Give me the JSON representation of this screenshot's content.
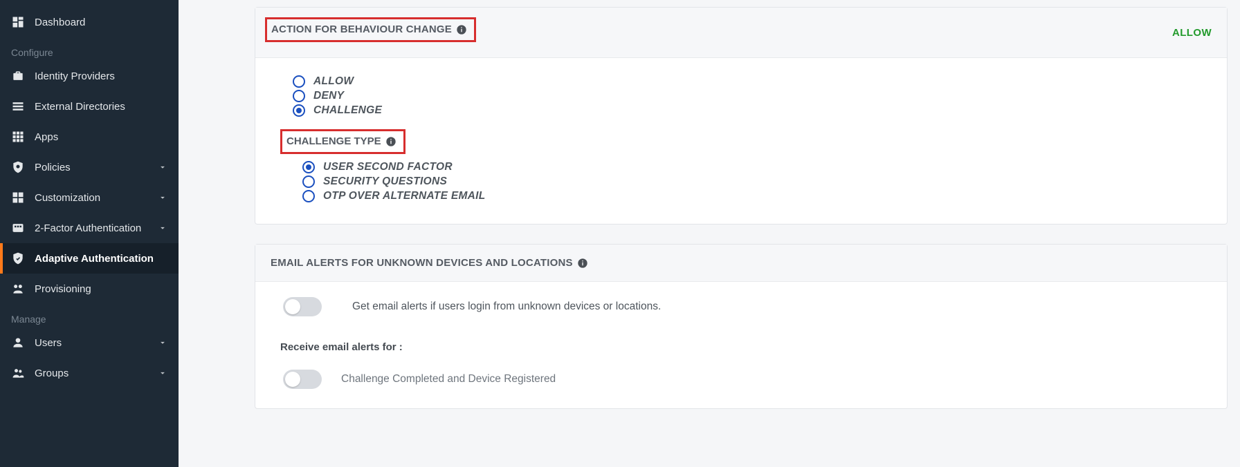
{
  "sidebar": {
    "configure_label": "Configure",
    "manage_label": "Manage",
    "items": {
      "dashboard": "Dashboard",
      "idp": "Identity Providers",
      "ext_dir": "External Directories",
      "apps": "Apps",
      "policies": "Policies",
      "customization": "Customization",
      "two_factor": "2-Factor Authentication",
      "adaptive_auth": "Adaptive Authentication",
      "provisioning": "Provisioning",
      "users": "Users",
      "groups": "Groups"
    }
  },
  "action_panel": {
    "title": "ACTION FOR BEHAVIOUR CHANGE",
    "status": "ALLOW",
    "options": {
      "allow": "ALLOW",
      "deny": "DENY",
      "challenge": "CHALLENGE"
    },
    "challenge_title": "CHALLENGE TYPE",
    "challenge_options": {
      "usf": "USER SECOND FACTOR",
      "sq": "SECURITY QUESTIONS",
      "otp": "OTP OVER ALTERNATE EMAIL"
    }
  },
  "email_panel": {
    "title": "EMAIL ALERTS FOR UNKNOWN DEVICES AND LOCATIONS",
    "toggle_text": "Get email alerts if users login from unknown devices or locations.",
    "receive_label": "Receive email alerts for :",
    "opt1": "Challenge Completed and Device Registered"
  }
}
